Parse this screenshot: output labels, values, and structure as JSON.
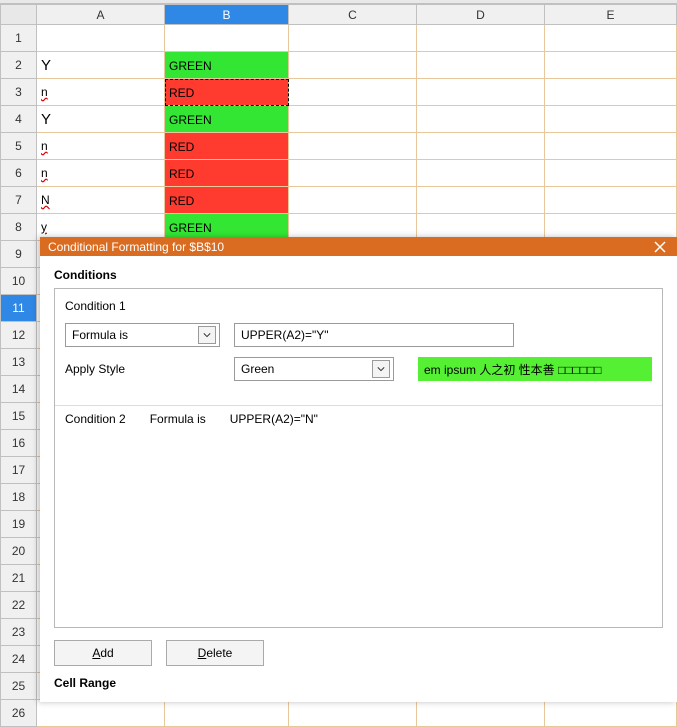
{
  "columns": [
    "A",
    "B",
    "C",
    "D",
    "E"
  ],
  "selected_col": "B",
  "selected_row": 11,
  "rows": 26,
  "cells": {
    "r2": {
      "A": "Y",
      "B": "GREEN",
      "Bclass": "green-cell"
    },
    "r3": {
      "A": "n",
      "Aclass": "underline-wavy",
      "B": "RED",
      "Bclass": "red-cell marquee"
    },
    "r4": {
      "A": "Y",
      "B": "GREEN",
      "Bclass": "green-cell"
    },
    "r5": {
      "A": "n",
      "Aclass": "underline-wavy",
      "B": "RED",
      "Bclass": "red-cell"
    },
    "r6": {
      "A": "n",
      "Aclass": "underline-wavy",
      "B": "RED",
      "Bclass": "red-cell"
    },
    "r7": {
      "A": "N",
      "Aclass": "underline-wavy",
      "B": "RED",
      "Bclass": "red-cell"
    },
    "r8": {
      "A": "y",
      "Aclass": "underline-wavy",
      "B": "GREEN",
      "Bclass": "green-cell"
    }
  },
  "dialog": {
    "title": "Conditional Formatting for $B$10",
    "sections": {
      "conditions": "Conditions",
      "cell_range": "Cell Range"
    },
    "cond1": {
      "title": "Condition 1",
      "type_select": "Formula is",
      "formula": "UPPER(A2)=\"Y\"",
      "apply_style_label": "Apply Style",
      "style_select": "Green",
      "preview_text": "em ipsum   人之初 性本善   □□□□□□"
    },
    "cond2": {
      "title": "Condition 2",
      "type_label": "Formula is",
      "formula": "UPPER(A2)=\"N\""
    },
    "buttons": {
      "add_pre": "A",
      "add": "dd",
      "delete_pre": "D",
      "delete": "elete"
    }
  }
}
